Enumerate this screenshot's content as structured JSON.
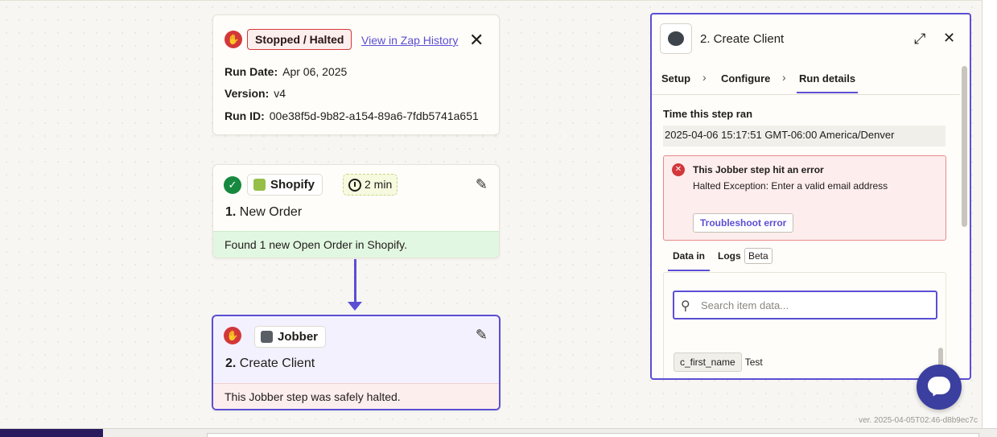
{
  "run": {
    "status": "Stopped / Halted",
    "history_link": "View in Zap History",
    "run_date_label": "Run Date:",
    "run_date": "Apr 06, 2025",
    "version_label": "Version:",
    "version": "v4",
    "run_id_label": "Run ID:",
    "run_id": "00e38f5d-9b82-a154-89a6-7fdb5741a651"
  },
  "steps": [
    {
      "app": "Shopify",
      "duration": "2 min",
      "number": "1.",
      "title": "New Order",
      "message": "Found 1 new Open Order in Shopify.",
      "status": "success"
    },
    {
      "app": "Jobber",
      "number": "2.",
      "title": "Create Client",
      "message": "This Jobber step was safely halted.",
      "status": "halted"
    }
  ],
  "panel": {
    "title": "2. Create Client",
    "tabs": [
      "Setup",
      "Configure",
      "Run details"
    ],
    "active_tab": "Run details",
    "time_label": "Time this step ran",
    "time_value": "2025-04-06 15:17:51 GMT-06:00 America/Denver",
    "error_title": "This Jobber step hit an error",
    "error_message": "Halted Exception: Enter a valid email address",
    "troubleshoot_label": "Troubleshoot error",
    "sub_tabs": [
      "Data in",
      "Logs"
    ],
    "beta_badge": "Beta",
    "search_placeholder": "Search item data...",
    "fields": [
      {
        "key": "c_first_name",
        "value": "Test"
      }
    ]
  },
  "footer": {
    "version": "ver. 2025-04-05T02:46-d8b9ec7c"
  },
  "colors": {
    "accent": "#5b4fd4",
    "error": "#d3373a",
    "success": "#16893f"
  },
  "icons": [
    "hand-stop-icon",
    "close-icon",
    "check-circle-icon",
    "shopify-logo-icon",
    "clock-icon",
    "edit-pencil-icon",
    "jobber-logo-icon",
    "expand-icon",
    "chevron-right-icon",
    "error-circle-icon",
    "search-icon",
    "chat-icon"
  ]
}
